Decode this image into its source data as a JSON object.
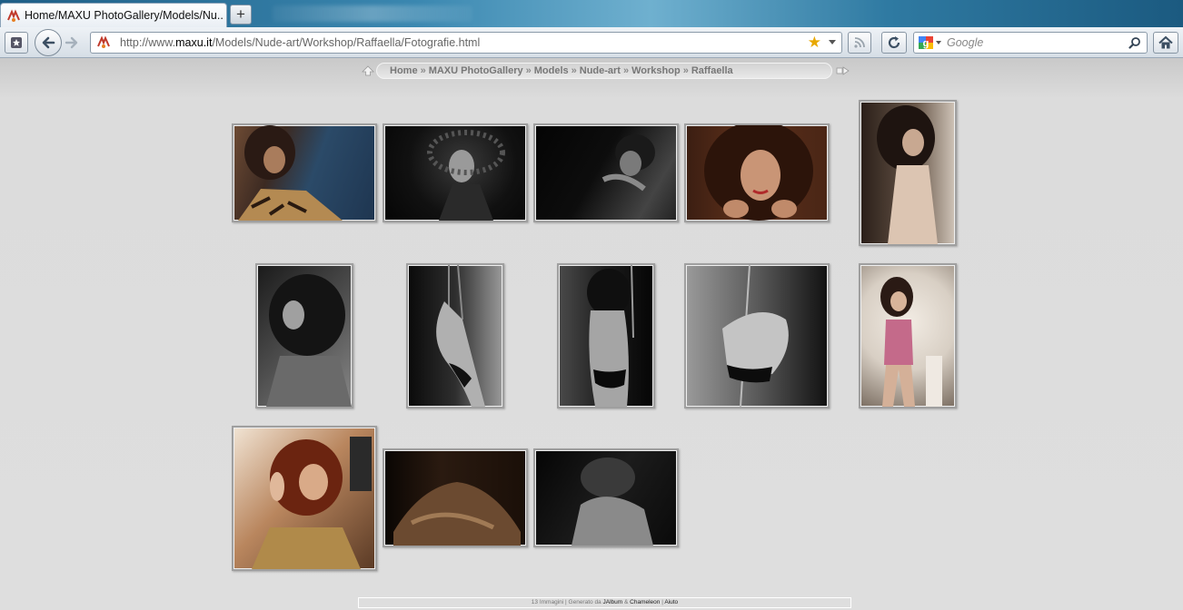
{
  "browser": {
    "tab_title": "Home/MAXU PhotoGallery/Models/Nu...",
    "new_tab_label": "+",
    "url_prefix": "http://www.",
    "url_domain": "maxu.it",
    "url_path": "/Models/Nude-art/Workshop/Raffaella/Fotografie.html",
    "search_placeholder": "Google"
  },
  "breadcrumb": {
    "items": [
      "Home",
      "MAXU PhotoGallery",
      "Models",
      "Nude-art",
      "Workshop",
      "Raffaella"
    ],
    "separator": "»"
  },
  "gallery": {
    "image_count": 13
  },
  "footer": {
    "count_text": "13 Immagini",
    "divider": "|",
    "generated_by": "Generato da",
    "jalbum": "JAlbum",
    "amp": "&",
    "skin": "Chameleon",
    "help": "Aiuto"
  }
}
